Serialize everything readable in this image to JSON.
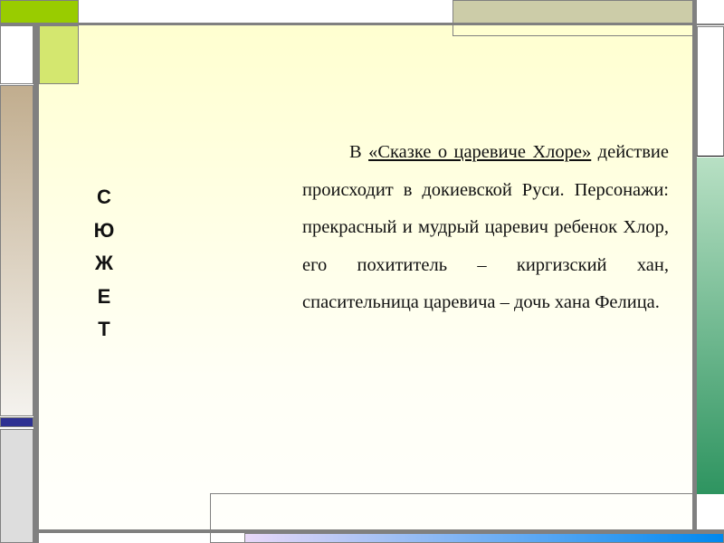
{
  "slide": {
    "title_letters": [
      "С",
      "Ю",
      "Ж",
      "Е",
      "Т"
    ],
    "paragraph": {
      "lead": "В ",
      "work_title": "«Сказке о царевиче Хлоре»",
      "rest": " действие происходит в докиевской Руси. Персонажи: прекрасный и мудрый царевич ребенок Хлор, его похититель – киргизский хан, спасительница царевича – дочь хана Фелица."
    }
  },
  "colors": {
    "background": "#ffffd0",
    "frame": "#808080",
    "accent_green": "#99cc00",
    "accent_blue": "#2e3192",
    "accent_teal": "#339966"
  }
}
